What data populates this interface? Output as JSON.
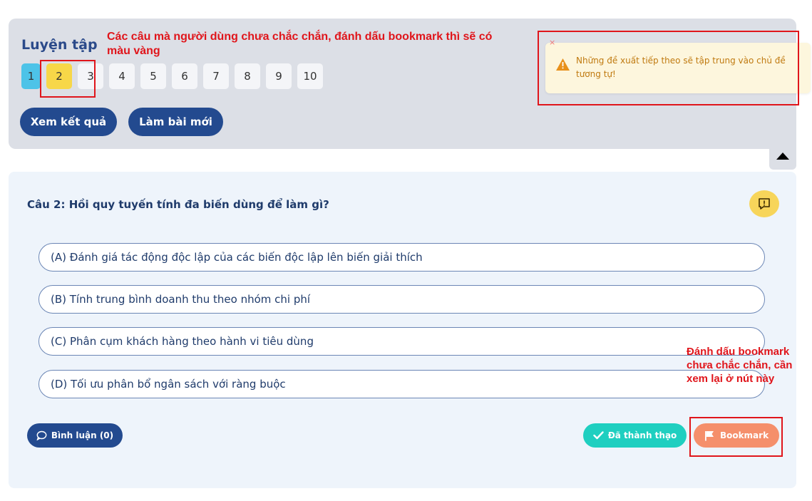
{
  "practice": {
    "title": "Luyện tập",
    "question_numbers": [
      "1",
      "2",
      "3",
      "4",
      "5",
      "6",
      "7",
      "8",
      "9",
      "10"
    ],
    "view_results_label": "Xem kết quả",
    "new_test_label": "Làm bài mới"
  },
  "toast": {
    "close": "×",
    "message": "Những đề xuất tiếp theo sẽ tập trung vào chủ đề tương tự!"
  },
  "question": {
    "text": "Câu 2: Hồi quy tuyến tính đa biến dùng để làm gì?",
    "options": [
      "(A) Đánh giá tác động độc lập của các biến độc lập lên biến giải thích",
      "(B) Tính trung bình doanh thu theo nhóm chi phí",
      "(C) Phân cụm khách hàng theo hành vi tiêu dùng",
      "(D) Tối ưu phân bổ ngân sách với ràng buộc"
    ]
  },
  "actions": {
    "comment_label": "Bình luận (0)",
    "mastered_label": "Đã thành thạo",
    "bookmark_label": "Bookmark"
  },
  "annotations": {
    "top": "Các câu mà người dùng chưa chắc chắn, đánh dấu bookmark thì sẽ có màu vàng",
    "right": "Đánh dấu bookmark chưa chắc chắn, cần xem lại ở nút này"
  },
  "colors": {
    "accent": "#234a8f",
    "bookmark": "#f58f6b",
    "mastered": "#1fcfc0",
    "highlight": "#f7d748",
    "annotation": "#e0151b"
  }
}
